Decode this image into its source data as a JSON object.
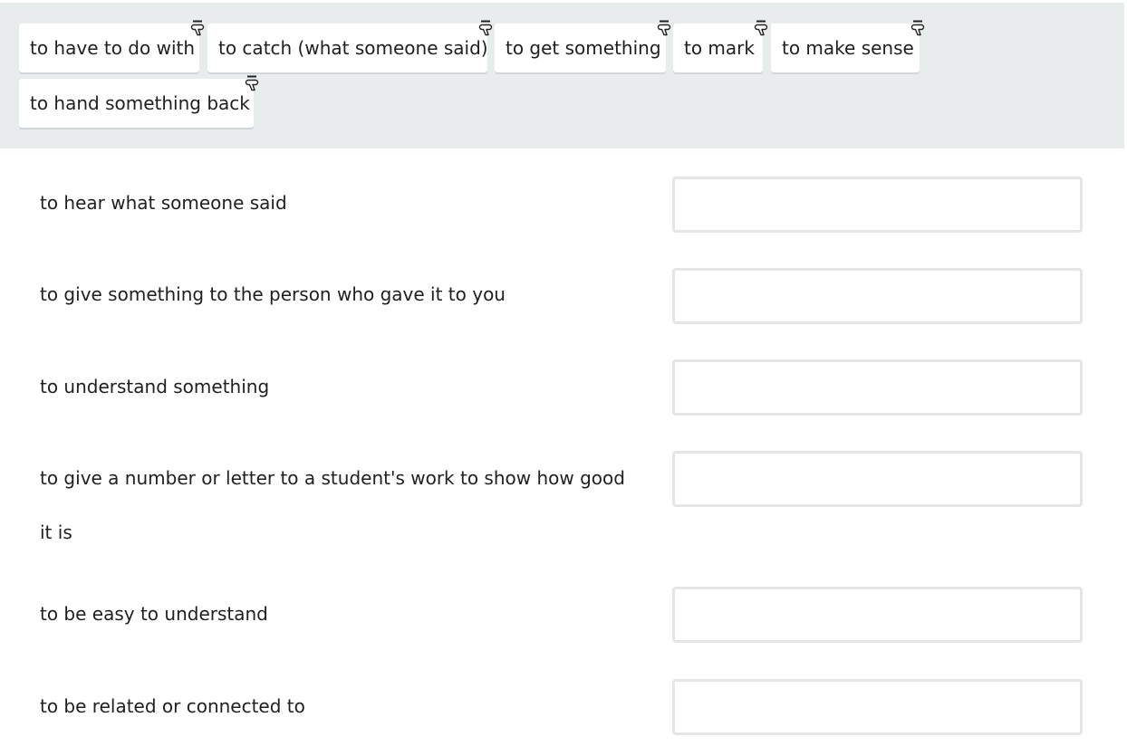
{
  "word_bank": {
    "chips": [
      {
        "label": "to have to do with",
        "icon": "drag-handle-icon"
      },
      {
        "label": "to catch (what someone said)",
        "icon": "drag-handle-icon"
      },
      {
        "label": "to get something",
        "icon": "drag-handle-icon"
      },
      {
        "label": "to mark",
        "icon": "drag-handle-icon"
      },
      {
        "label": "to make sense",
        "icon": "drag-handle-icon"
      },
      {
        "label": "to hand something back",
        "icon": "drag-handle-icon"
      }
    ]
  },
  "matching": {
    "rows": [
      {
        "definition": "to hear what someone said",
        "answer": ""
      },
      {
        "definition": "to give something to the person who gave it to you",
        "answer": ""
      },
      {
        "definition": "to understand something",
        "answer": ""
      },
      {
        "definition": "to give a number or letter to a student's work to show how good it is",
        "answer": ""
      },
      {
        "definition": "to be easy to understand",
        "answer": ""
      },
      {
        "definition": "to be related or connected to",
        "answer": ""
      }
    ]
  },
  "colors": {
    "bank_background": "#e9eced",
    "chip_background": "#ffffff",
    "drop_zone_border": "#e3e5e6",
    "text": "#1f1f1f"
  }
}
